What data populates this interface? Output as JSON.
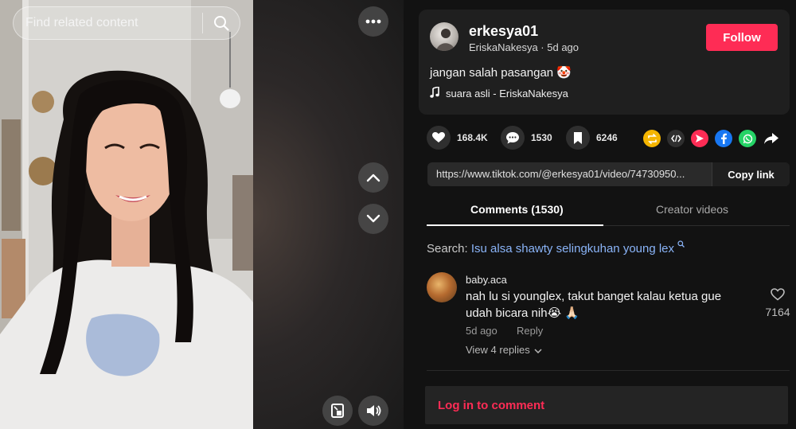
{
  "search": {
    "placeholder": "Find related content"
  },
  "video": {
    "more_icon": "more-horizontal-icon",
    "up_icon": "chevron-up-icon",
    "down_icon": "chevron-down-icon",
    "pip_icon": "picture-in-picture-icon",
    "volume_icon": "volume-icon"
  },
  "author": {
    "username": "erkesya01",
    "meta": "EriskaNakesya · 5d ago",
    "follow_label": "Follow",
    "caption": "jangan salah pasangan 🤡",
    "music": "suara asli - EriskaNakesya"
  },
  "stats": {
    "likes": "168.4K",
    "comments": "1530",
    "saves": "6246"
  },
  "share": {
    "icons": [
      "repost-icon",
      "embed-icon",
      "send-icon",
      "facebook-icon",
      "whatsapp-icon",
      "share-arrow-icon"
    ],
    "colors": {
      "repost": "#f5b500",
      "embed": "#2f2f2f",
      "send": "#fe2c55",
      "facebook": "#1877f2",
      "whatsapp": "#25d366"
    }
  },
  "link": {
    "url": "https://www.tiktok.com/@erkesya01/video/74730950...",
    "copy_label": "Copy link"
  },
  "tabs": [
    {
      "label": "Comments (1530)",
      "active": true
    },
    {
      "label": "Creator videos",
      "active": false
    }
  ],
  "search_suggest": {
    "label": "Search:",
    "query": "Isu alsa shawty selingkuhan young lex"
  },
  "comments": [
    {
      "user": "baby.aca",
      "text": "nah lu si younglex, takut banget kalau ketua gue udah bicara nih😭 🙏🏻",
      "date": "5d ago",
      "reply_label": "Reply",
      "replies_label": "View 4 replies",
      "likes": "7164"
    }
  ],
  "login": {
    "label": "Log in to comment"
  },
  "colors": {
    "accent": "#fe2c55",
    "link": "#8ab4f8",
    "panel": "#121212",
    "card": "#1f1f1f"
  }
}
